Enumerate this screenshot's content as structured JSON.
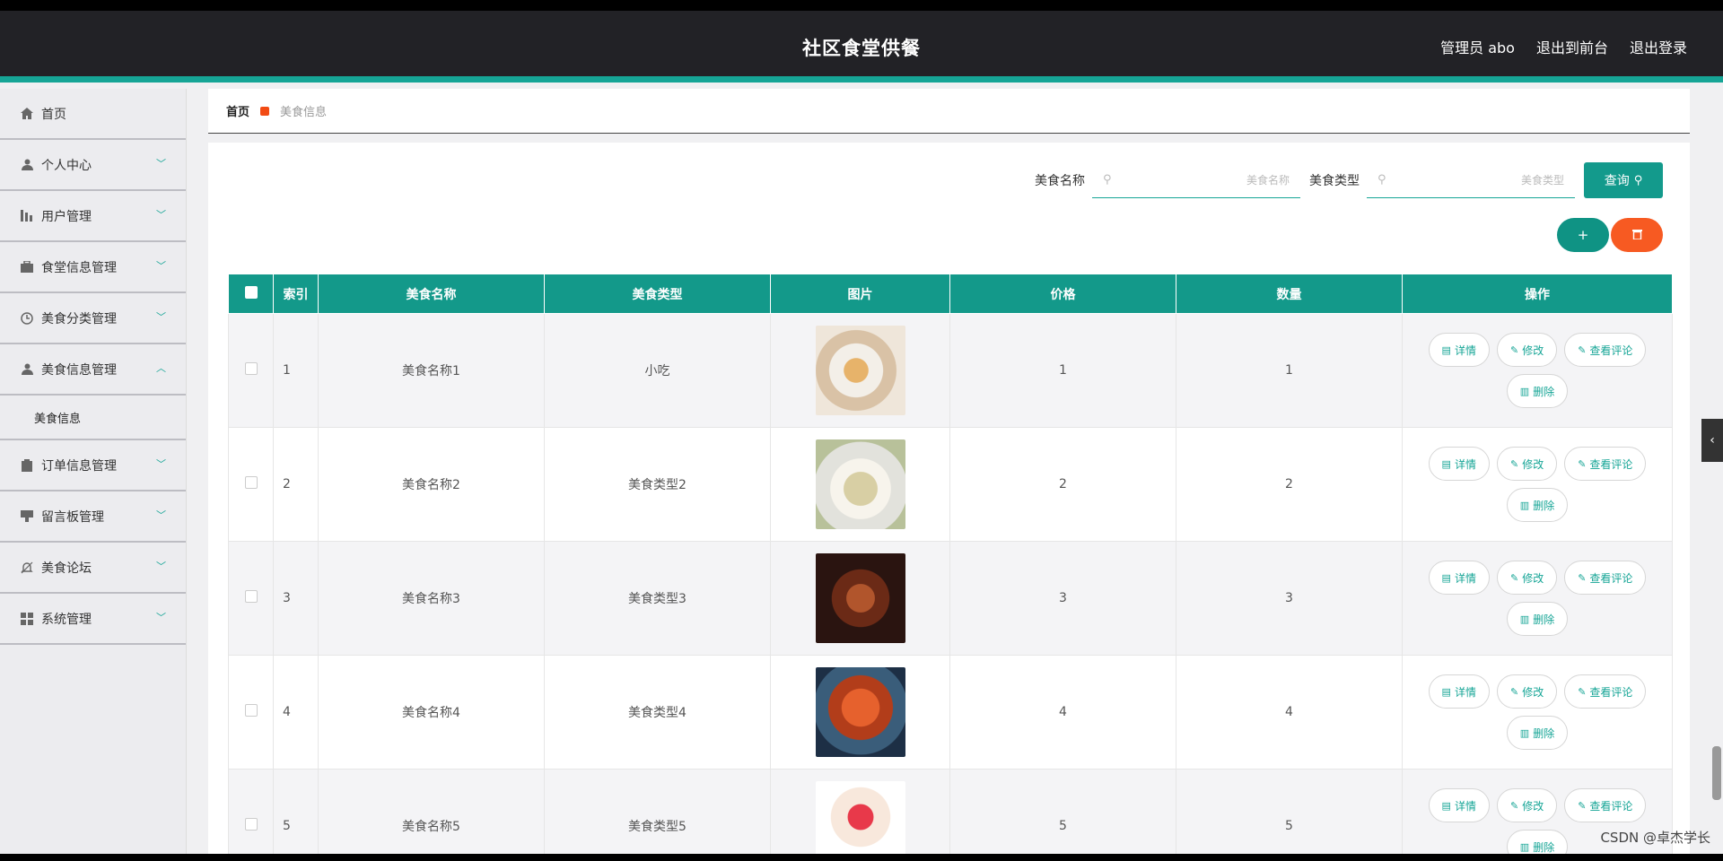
{
  "header": {
    "title": "社区食堂供餐",
    "links": [
      "管理员 abo",
      "退出到前台",
      "退出登录"
    ]
  },
  "sidebar": {
    "items": [
      {
        "label": "首页",
        "icon": "home-icon"
      },
      {
        "label": "个人中心",
        "icon": "user-icon"
      },
      {
        "label": "用户管理",
        "icon": "chart-icon"
      },
      {
        "label": "食堂信息管理",
        "icon": "briefcase-icon"
      },
      {
        "label": "美食分类管理",
        "icon": "clock-icon"
      },
      {
        "label": "美食信息管理",
        "icon": "user-icon"
      },
      {
        "label": "订单信息管理",
        "icon": "clipboard-icon"
      },
      {
        "label": "留言板管理",
        "icon": "board-icon"
      },
      {
        "label": "美食论坛",
        "icon": "bell-icon"
      },
      {
        "label": "系统管理",
        "icon": "grid-icon"
      }
    ],
    "sub_item": "美食信息"
  },
  "breadcrumb": {
    "home": "首页",
    "current": "美食信息"
  },
  "search": {
    "name_label": "美食名称",
    "name_placeholder": "美食名称",
    "type_label": "美食类型",
    "type_placeholder": "美食类型",
    "query_label": "查询"
  },
  "table": {
    "headers": [
      "索引",
      "美食名称",
      "美食类型",
      "图片",
      "价格",
      "数量",
      "操作"
    ],
    "rows": [
      {
        "index": "1",
        "name": "美食名称1",
        "type": "小吃",
        "price": "1",
        "qty": "1"
      },
      {
        "index": "2",
        "name": "美食名称2",
        "type": "美食类型2",
        "price": "2",
        "qty": "2"
      },
      {
        "index": "3",
        "name": "美食名称3",
        "type": "美食类型3",
        "price": "3",
        "qty": "3"
      },
      {
        "index": "4",
        "name": "美食名称4",
        "type": "美食类型4",
        "price": "4",
        "qty": "4"
      },
      {
        "index": "5",
        "name": "美食名称5",
        "type": "美食类型5",
        "price": "5",
        "qty": "5"
      }
    ],
    "actions": {
      "detail": "详情",
      "edit": "修改",
      "comments": "查看评论",
      "delete": "删除"
    }
  },
  "colors": {
    "accent": "#16a596",
    "danger": "#f75a22",
    "header_bg": "#222226"
  },
  "watermark": "CSDN @卓杰学长"
}
